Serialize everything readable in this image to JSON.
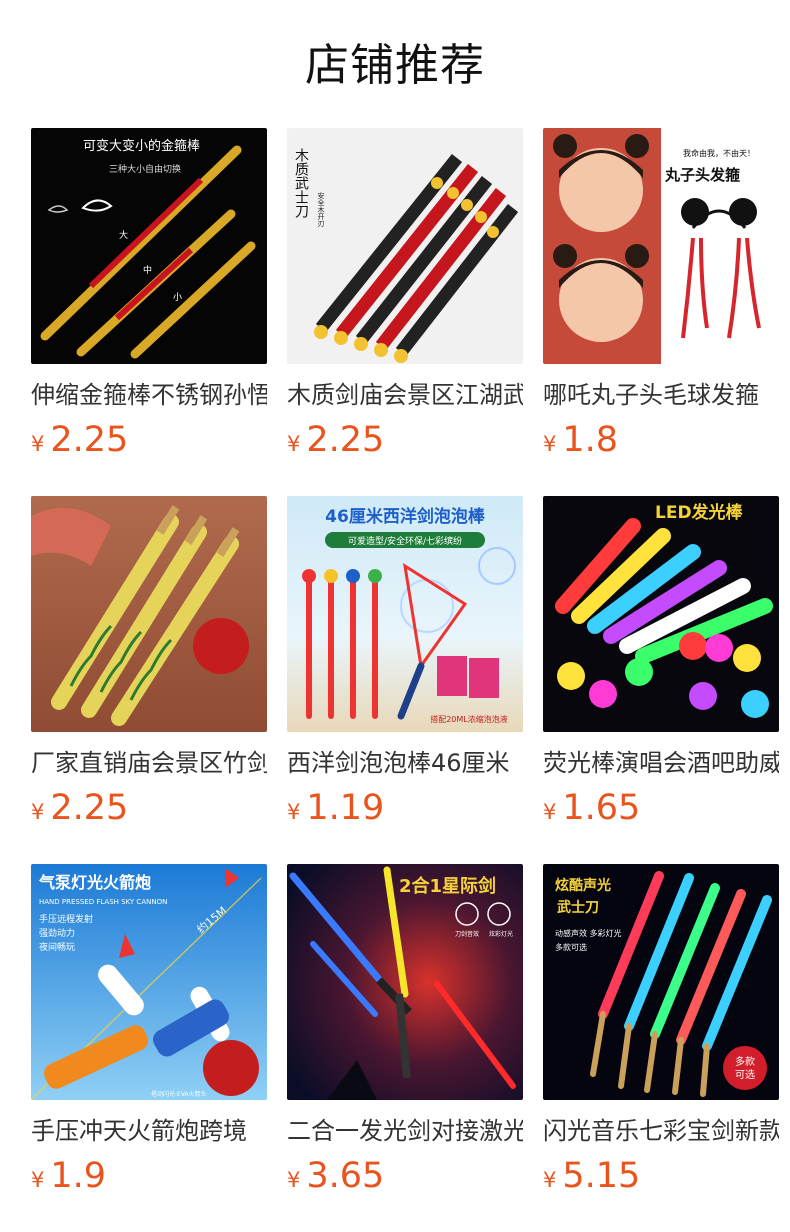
{
  "page": {
    "title": "店铺推荐"
  },
  "currency_symbol": "¥",
  "products": [
    {
      "name": "伸缩金箍棒不锈钢孙悟空",
      "price": "2.25",
      "image_icon": "golden-staff-image",
      "image_text": [
        "可变大变小的金箍棒",
        "三种大小自由切换",
        "大",
        "中",
        "小"
      ]
    },
    {
      "name": "木质剑庙会景区江湖武士刀",
      "price": "2.25",
      "image_icon": "wooden-samurai-swords-image",
      "image_text": [
        "木质武士刀",
        "安全木开刃"
      ]
    },
    {
      "name": "哪吒丸子头毛球发箍",
      "price": "1.8",
      "image_icon": "nezha-bun-headband-image",
      "image_text": [
        "我命由我，不由天！",
        "丸子头发箍"
      ]
    },
    {
      "name": "厂家直销庙会景区竹剑",
      "price": "2.25",
      "image_icon": "bamboo-dragon-swords-image",
      "image_text": []
    },
    {
      "name": "西洋剑泡泡棒46厘米",
      "price": "1.19",
      "image_icon": "bubble-sword-image",
      "image_text": [
        "46厘米西洋剑泡泡棒",
        "可爱造型/安全环保/七彩缤纷",
        "搭配20ML浓缩泡泡液"
      ]
    },
    {
      "name": "荧光棒演唱会酒吧助威",
      "price": "1.65",
      "image_icon": "led-glow-sticks-image",
      "image_text": [
        "LED发光棒"
      ]
    },
    {
      "name": "手压冲天火箭炮跨境",
      "price": "1.9",
      "image_icon": "air-rocket-launcher-image",
      "image_text": [
        "气泵灯光火箭炮",
        "HAND PRESSED FLASH SKY CANNON",
        "手压远程发射",
        "强劲动力",
        "夜间畅玩",
        "约15M",
        "搭动闪光·EVA火箭头"
      ]
    },
    {
      "name": "二合一发光剑对接激光剑",
      "price": "3.65",
      "image_icon": "star-wars-lightsaber-image",
      "image_text": [
        "2合1星际剑",
        "刀剑音效",
        "炫彩灯光"
      ]
    },
    {
      "name": "闪光音乐七彩宝剑新款",
      "price": "5.15",
      "image_icon": "flash-music-swords-image",
      "image_text": [
        "炫酷声光",
        "武士刀",
        "动感声效 多彩灯光",
        "多款可选",
        "多款",
        "可选"
      ]
    }
  ]
}
